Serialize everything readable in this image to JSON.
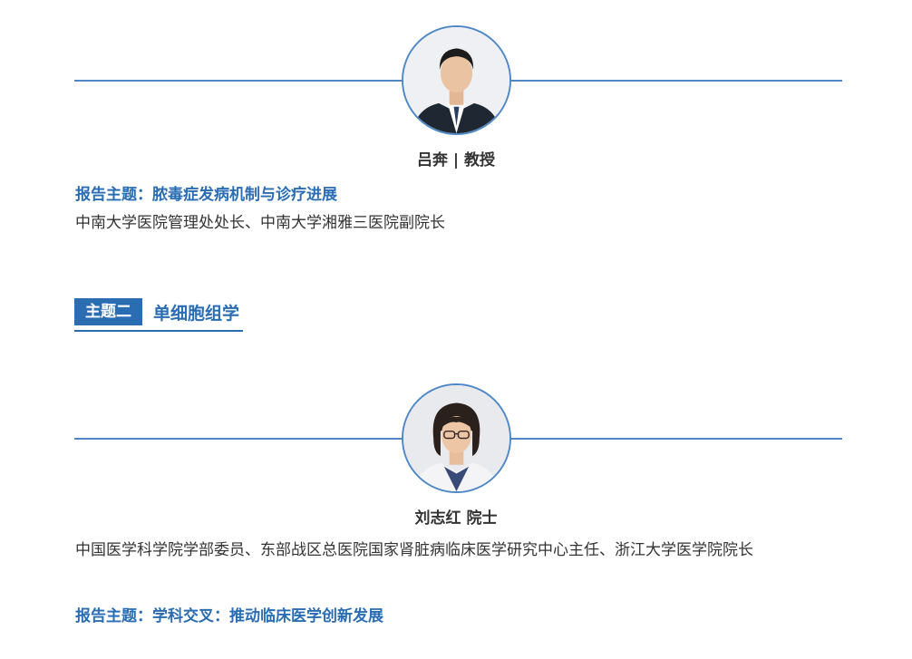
{
  "speakers": [
    {
      "name_title": "吕奔 | 教授",
      "topic": "报告主题：脓毒症发病机制与诊疗进展",
      "affiliation": "中南大学医院管理处处长、中南大学湘雅三医院副院长",
      "avatar_icon": "male-portrait-icon"
    },
    {
      "name_title": "刘志红 院士",
      "affiliation": "中国医学科学院学部委员、东部战区总医院国家肾脏病临床医学研究中心主任、浙江大学医学院院长",
      "topic": "报告主题：学科交叉：推动临床医学创新发展",
      "avatar_icon": "female-portrait-icon"
    }
  ],
  "section": {
    "tag": "主题二",
    "title": "单细胞组学"
  },
  "colors": {
    "accent": "#2a6db3",
    "divider": "#4f88c6",
    "text": "#333333"
  }
}
